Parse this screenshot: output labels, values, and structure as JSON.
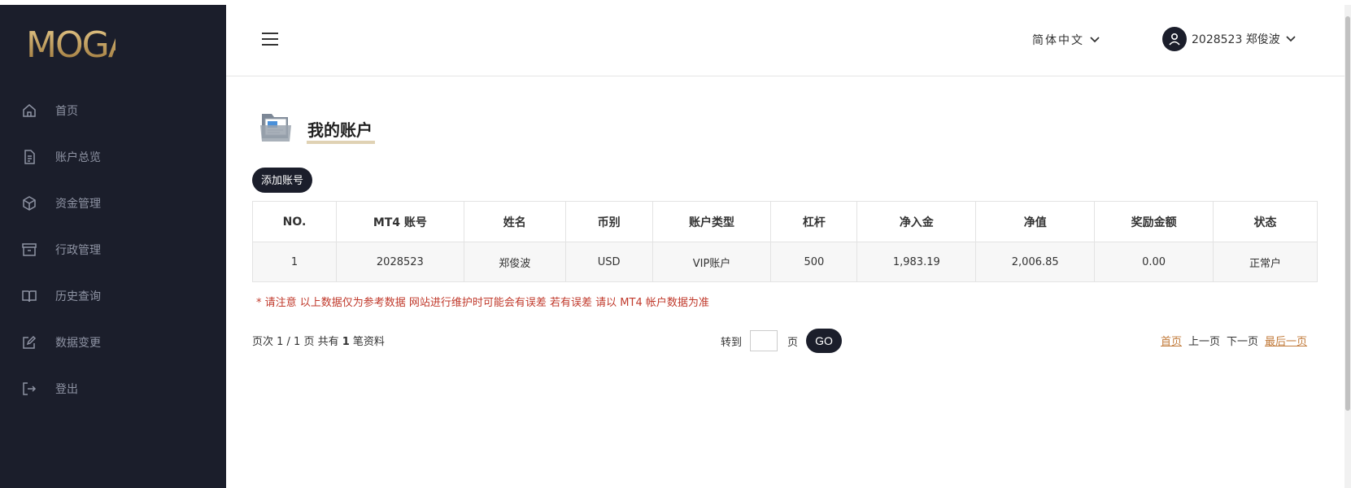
{
  "brand": {
    "logo_text": "MOGA",
    "logo_color": "#b8975a"
  },
  "sidebar": {
    "items": [
      {
        "label": "首页",
        "icon": "home-icon"
      },
      {
        "label": "账户总览",
        "icon": "document-icon"
      },
      {
        "label": "资金管理",
        "icon": "cube-icon"
      },
      {
        "label": "行政管理",
        "icon": "archive-icon"
      },
      {
        "label": "历史查询",
        "icon": "book-icon"
      },
      {
        "label": "数据变更",
        "icon": "edit-icon"
      },
      {
        "label": "登出",
        "icon": "logout-icon"
      }
    ]
  },
  "header": {
    "language": "简体中文",
    "user": "2028523 郑俊波"
  },
  "main": {
    "title": "我的账户",
    "add_button": "添加账号",
    "table": {
      "headers": [
        "NO.",
        "MT4 账号",
        "姓名",
        "币别",
        "账户类型",
        "杠杆",
        "净入金",
        "净值",
        "奖励金额",
        "状态"
      ],
      "rows": [
        [
          "1",
          "2028523",
          "郑俊波",
          "USD",
          "VIP账户",
          "500",
          "1,983.19",
          "2,006.85",
          "0.00",
          "正常户"
        ]
      ]
    },
    "note": "* 请注意 以上数据仅为参考数据 网站进行维护时可能会有误差 若有误差 请以 MT4 帐户数据为准",
    "pager": {
      "info_prefix": "页次 1 / 1 页   共有",
      "total": "1",
      "info_suffix": "笔资料",
      "goto_label": "转到",
      "page_word": "页",
      "go": "GO",
      "first": "首页",
      "prev": "上一页",
      "next": "下一页",
      "last": "最后一页"
    }
  },
  "colors": {
    "sidebar_bg": "#1b1e2b",
    "accent": "#c17a3a",
    "note": "#c0392b"
  }
}
